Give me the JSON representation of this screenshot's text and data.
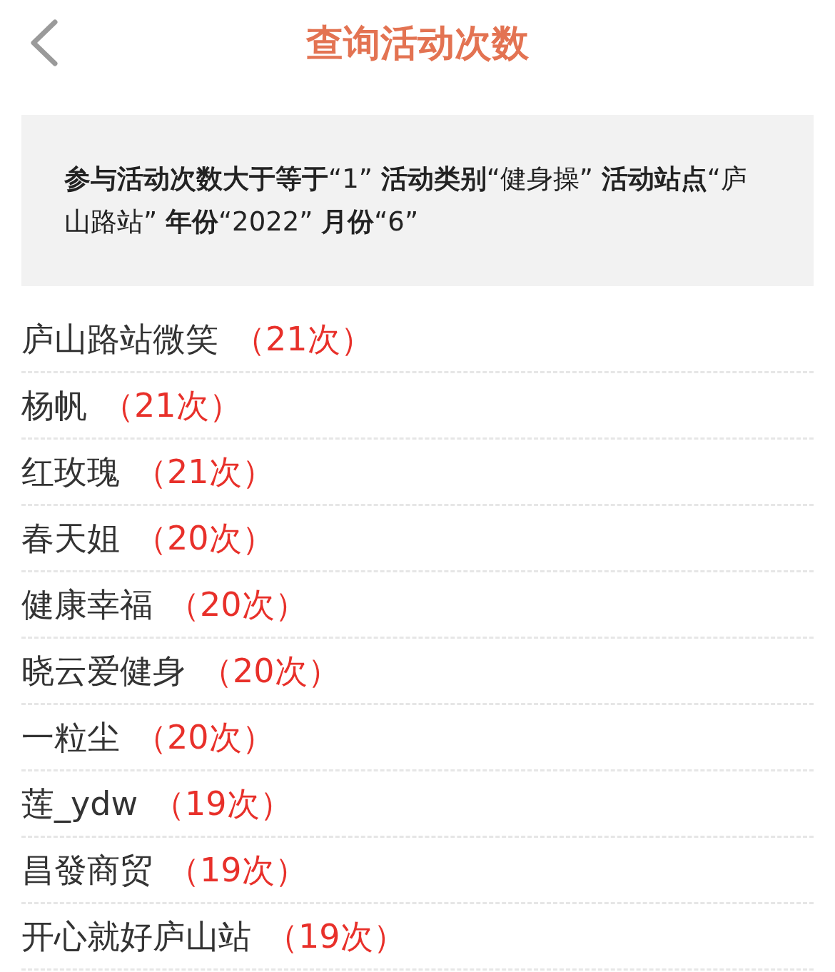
{
  "header": {
    "title": "查询活动次数"
  },
  "summary": "**参与活动次数大于等于**“1” **活动类别**“健身操” **活动站点**“庐山路站” **年份**“2022” **月份**“6”",
  "results": [
    {
      "name": "庐山路站微笑",
      "count": "（21次）"
    },
    {
      "name": "杨帆",
      "count": "（21次）"
    },
    {
      "name": "红玫瑰",
      "count": "（21次）"
    },
    {
      "name": "春天姐",
      "count": "（20次）"
    },
    {
      "name": "健康幸福",
      "count": "（20次）"
    },
    {
      "name": "晓云爱健身",
      "count": "（20次）"
    },
    {
      "name": "一粒尘",
      "count": "（20次）"
    },
    {
      "name": "莲_ydw",
      "count": "（19次）"
    },
    {
      "name": "昌發商贸",
      "count": "（19次）"
    },
    {
      "name": "开心就好庐山站",
      "count": "（19次）"
    }
  ]
}
